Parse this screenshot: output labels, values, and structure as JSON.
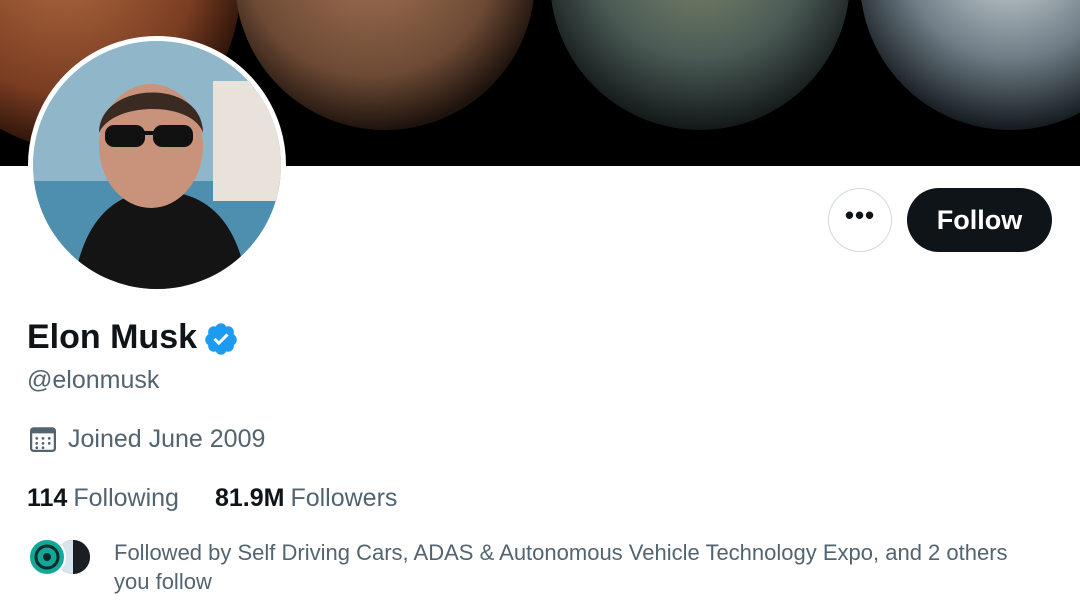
{
  "profile": {
    "name": "Elon Musk",
    "handle": "@elonmusk",
    "joined": "Joined June 2009",
    "following_count": "114",
    "following_label": "Following",
    "followers_count": "81.9M",
    "followers_label": "Followers",
    "followed_by": "Followed by Self Driving Cars, ADAS & Autonomous Vehicle Technology Expo, and 2 others you follow"
  },
  "actions": {
    "more_label": "•••",
    "follow_label": "Follow"
  },
  "icons": {
    "verified": "verified-badge-icon",
    "calendar": "calendar-icon",
    "more": "more-icon"
  },
  "colors": {
    "primary_text": "#0f1419",
    "secondary_text": "#536471",
    "verified_blue": "#1d9bf0",
    "follow_button_bg": "#0f1419",
    "border": "#cfd9de"
  }
}
